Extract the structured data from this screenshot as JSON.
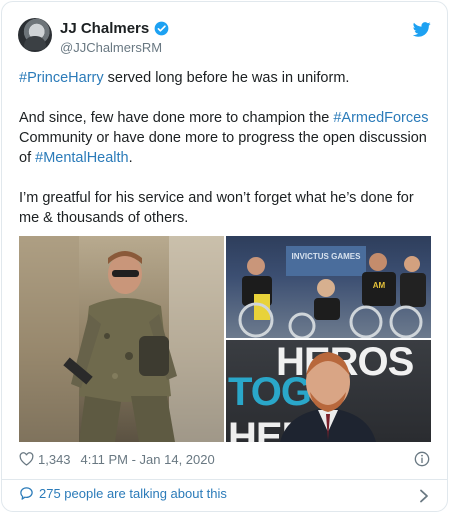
{
  "author": {
    "name": "JJ Chalmers",
    "handle": "@JJChalmersRM",
    "verified": true
  },
  "icons": {
    "avatar": "avatar-photo",
    "verified": "verified-badge-icon",
    "logo": "twitter-bird-icon",
    "like": "heart-icon",
    "info": "info-icon",
    "reply": "speech-bubble-icon",
    "chevron": "chevron-right-icon"
  },
  "tweet": {
    "p1": {
      "tag": "#PrinceHarry",
      "rest": " served long before he was in uniform."
    },
    "p2": {
      "before": "And since, few have done more to champion the ",
      "tag1": "#ArmedForces",
      "middle": " Community or have done more to progress the open discussion of ",
      "tag2": "#MentalHealth",
      "after": "."
    },
    "p3": "I’m greatful for his service and won’t forget what he’s done for me & thousands of others."
  },
  "media": {
    "sign_text": "INVICTUS GAMES",
    "shirt_text": "AM",
    "banner_top": "HEROS",
    "banner_bottom_1": "TOG",
    "banner_bottom_2": "HER"
  },
  "meta": {
    "likes": "1,343",
    "timestamp": "4:11 PM - Jan 14, 2020"
  },
  "footer": {
    "conversation": "275 people are talking about this"
  },
  "colors": {
    "link": "#2b7bb9",
    "verified": "#1da1f2",
    "muted": "#697882",
    "border": "#e1e8ed"
  }
}
